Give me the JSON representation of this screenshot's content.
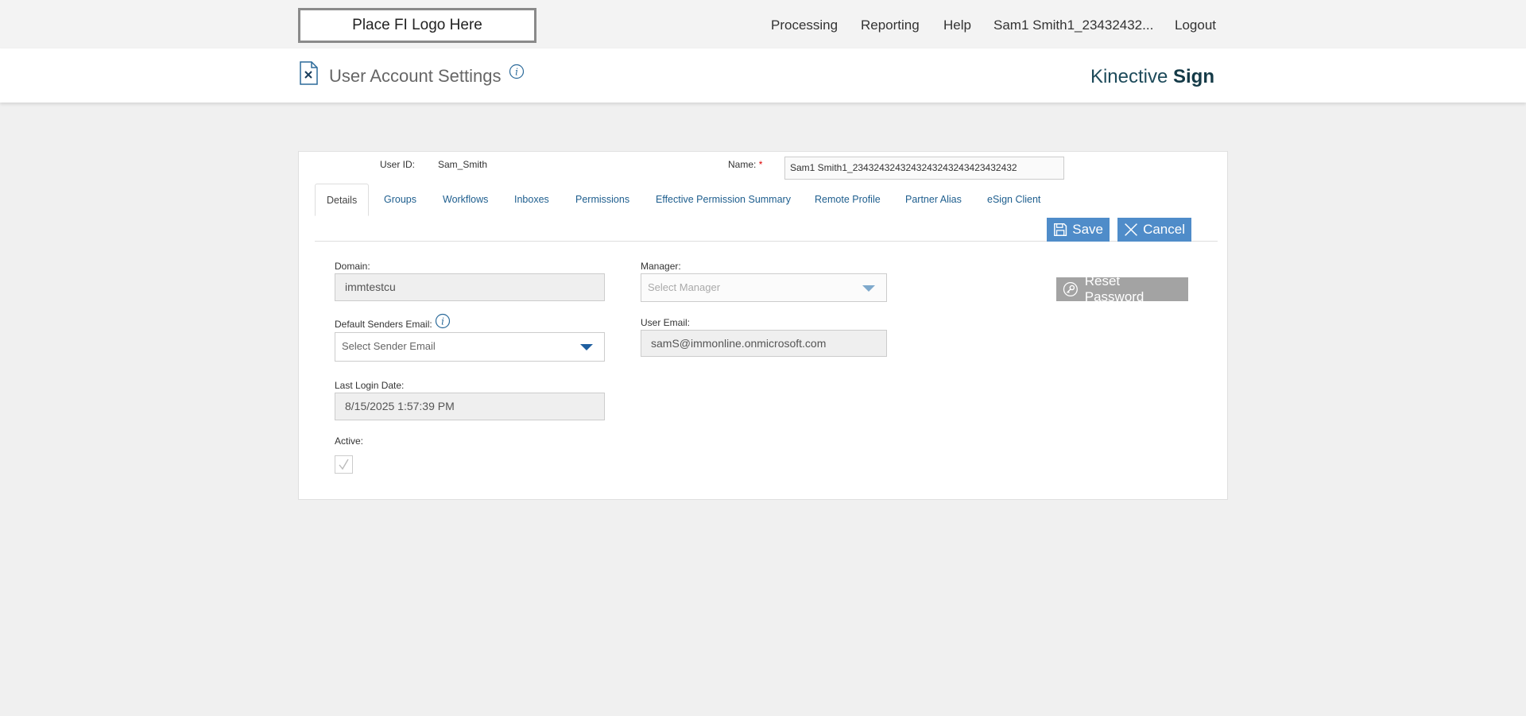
{
  "topbar": {
    "logo_text": "Place FI Logo Here",
    "nav": {
      "processing": "Processing",
      "reporting": "Reporting",
      "help": "Help",
      "user": "Sam1 Smith1_23432432...",
      "logout": "Logout"
    }
  },
  "header": {
    "title": "User Account Settings",
    "brand_light": "Kinective ",
    "brand_bold": "Sign"
  },
  "user": {
    "id_label": "User ID:",
    "id_value": "Sam_Smith",
    "name_label": "Name:",
    "name_required": "*",
    "name_value": "Sam1 Smith1_2343243243243243243243423432432"
  },
  "tabs": [
    {
      "label": "Details",
      "active": true
    },
    {
      "label": "Groups"
    },
    {
      "label": "Workflows"
    },
    {
      "label": "Inboxes"
    },
    {
      "label": "Permissions"
    },
    {
      "label": "Effective Permission Summary"
    },
    {
      "label": "Remote Profile"
    },
    {
      "label": "Partner Alias"
    },
    {
      "label": "eSign Client"
    }
  ],
  "actions": {
    "save": "Save",
    "cancel": "Cancel",
    "reset_password": "Reset Password"
  },
  "form": {
    "domain_label": "Domain:",
    "domain_value": "immtestcu",
    "sender_label": "Default Senders Email:",
    "sender_placeholder": "Select Sender Email",
    "last_login_label": "Last Login Date:",
    "last_login_value": "8/15/2025 1:57:39 PM",
    "active_label": "Active:",
    "active_checked": true,
    "manager_label": "Manager:",
    "manager_placeholder": "Select Manager",
    "email_label": "User Email:",
    "email_value": "samS@immonline.onmicrosoft.com"
  },
  "colors": {
    "accent": "#4f8cc9",
    "link": "#1e5e8e",
    "caret_active": "#1f5fa0",
    "caret_disabled": "#7fa9cc",
    "reset_button": "#a3a3a3"
  }
}
